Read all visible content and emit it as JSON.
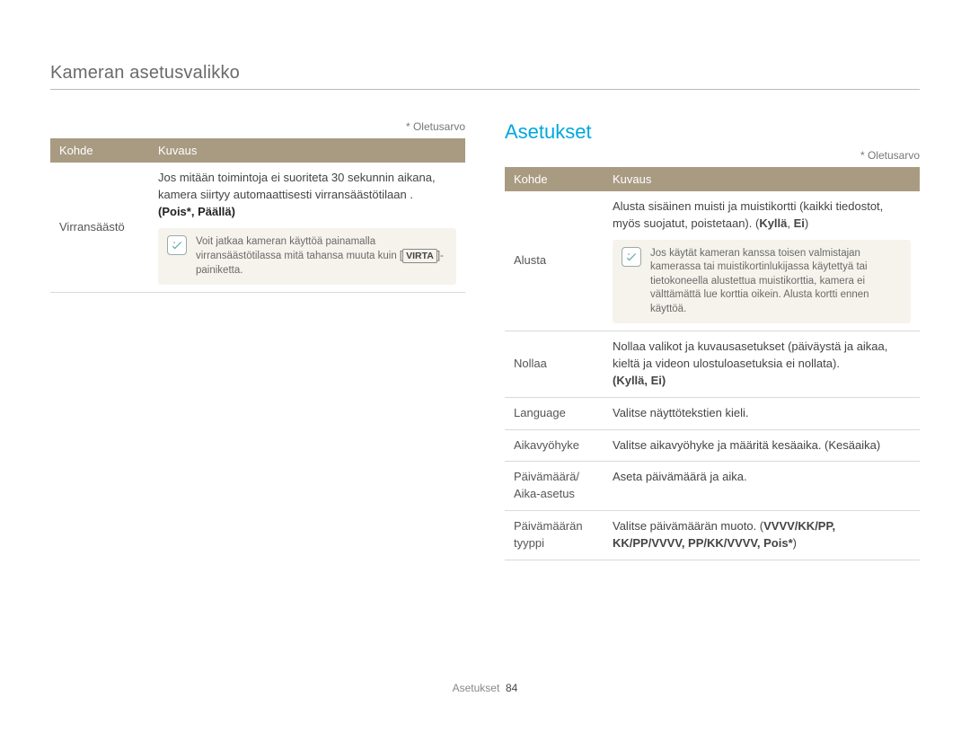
{
  "breadcrumb": "Kameran asetusvalikko",
  "left": {
    "default_note": "* Oletusarvo",
    "table": {
      "headers": {
        "col1": "Kohde",
        "col2": "Kuvaus"
      },
      "rows": [
        {
          "label": "Virransäästö",
          "desc": "Jos mitään toimintoja ei suoriteta 30 sekunnin aikana, kamera siirtyy automaattisesti virransäästötilaan .",
          "options": "(Pois*, Päällä)",
          "info_pre": "Voit jatkaa kameran käyttöä painamalla virransäästötilassa mitä tahansa muuta kuin [",
          "info_boxed": "VIRTA",
          "info_post": "]-painiketta."
        }
      ]
    }
  },
  "right": {
    "section_title": "Asetukset",
    "default_note": "* Oletusarvo",
    "table": {
      "headers": {
        "col1": "Kohde",
        "col2": "Kuvaus"
      },
      "rows": [
        {
          "label": "Alusta",
          "desc": "Alusta sisäinen muisti ja muistikortti (kaikki tiedostot, myös suojatut, poistetaan). (",
          "options_bold": "Kyllä",
          "options_sep": ", ",
          "options_bold2": "Ei",
          "options_close": ")",
          "info": "Jos käytät kameran kanssa toisen valmistajan kamerassa tai muistikortinlukijassa käytettyä tai tietokoneella alustettua muistikorttia, kamera ei välttämättä lue korttia oikein. Alusta kortti ennen käyttöä."
        },
        {
          "label": "Nollaa",
          "desc": "Nollaa valikot ja kuvausasetukset (päiväystä ja aikaa, kieltä ja videon ulostuloasetuksia ei nollata).",
          "options_line": "(Kyllä, Ei)"
        },
        {
          "label": "Language",
          "desc": "Valitse näyttötekstien kieli."
        },
        {
          "label": "Aikavyöhyke",
          "desc": "Valitse aikavyöhyke ja määritä kesäaika. (Kesäaika)"
        },
        {
          "label": "Päivämäärä/ Aika-asetus",
          "desc": "Aseta päivämäärä ja aika."
        },
        {
          "label": "Päivämäärän tyyppi",
          "desc_pre": "Valitse päivämäärän muoto. (",
          "options_bold_line": "VVVV/KK/PP, KK/PP/VVVV, PP/KK/VVVV, Pois*",
          "desc_post": ")"
        }
      ]
    }
  },
  "footer": {
    "section": "Asetukset",
    "page": "84"
  }
}
